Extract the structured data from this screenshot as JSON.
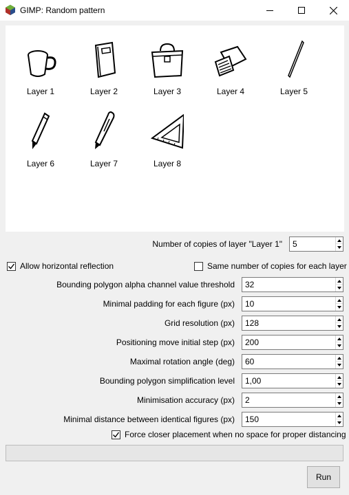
{
  "window": {
    "title": "GIMP: Random pattern",
    "icon": "gimp-icon"
  },
  "titlebar_buttons": [
    "minimize-icon",
    "maximize-icon",
    "close-icon"
  ],
  "layers": [
    {
      "label": "Layer 1",
      "icon": "mug-icon"
    },
    {
      "label": "Layer 2",
      "icon": "notebook-icon"
    },
    {
      "label": "Layer 3",
      "icon": "briefcase-icon"
    },
    {
      "label": "Layer 4",
      "icon": "calculator-icon"
    },
    {
      "label": "Layer 5",
      "icon": "needle-icon"
    },
    {
      "label": "Layer 6",
      "icon": "pencil-icon"
    },
    {
      "label": "Layer 7",
      "icon": "pen-icon"
    },
    {
      "label": "Layer 8",
      "icon": "set-square-icon"
    }
  ],
  "copies": {
    "label": "Number of copies of layer \"Layer 1\"",
    "value": "5"
  },
  "allow_reflection": {
    "label": "Allow horizontal reflection",
    "checked": true
  },
  "same_copies": {
    "label": "Same number of copies for each layer",
    "checked": false
  },
  "params": [
    {
      "label": "Bounding polygon alpha channel value threshold",
      "value": "32"
    },
    {
      "label": "Minimal padding for each figure (px)",
      "value": "10"
    },
    {
      "label": "Grid resolution (px)",
      "value": "128"
    },
    {
      "label": "Positioning move initial step (px)",
      "value": "200"
    },
    {
      "label": "Maximal rotation angle (deg)",
      "value": "60"
    },
    {
      "label": "Bounding polygon simplification level",
      "value": "1,00"
    },
    {
      "label": "Minimisation accuracy (px)",
      "value": "2"
    },
    {
      "label": "Minimal distance between identical figures (px)",
      "value": "150"
    }
  ],
  "force_closer": {
    "label": "Force closer placement when no space for proper distancing",
    "checked": true
  },
  "progress": {
    "text": "",
    "fraction": 0
  },
  "run_button": {
    "label": "Run"
  }
}
